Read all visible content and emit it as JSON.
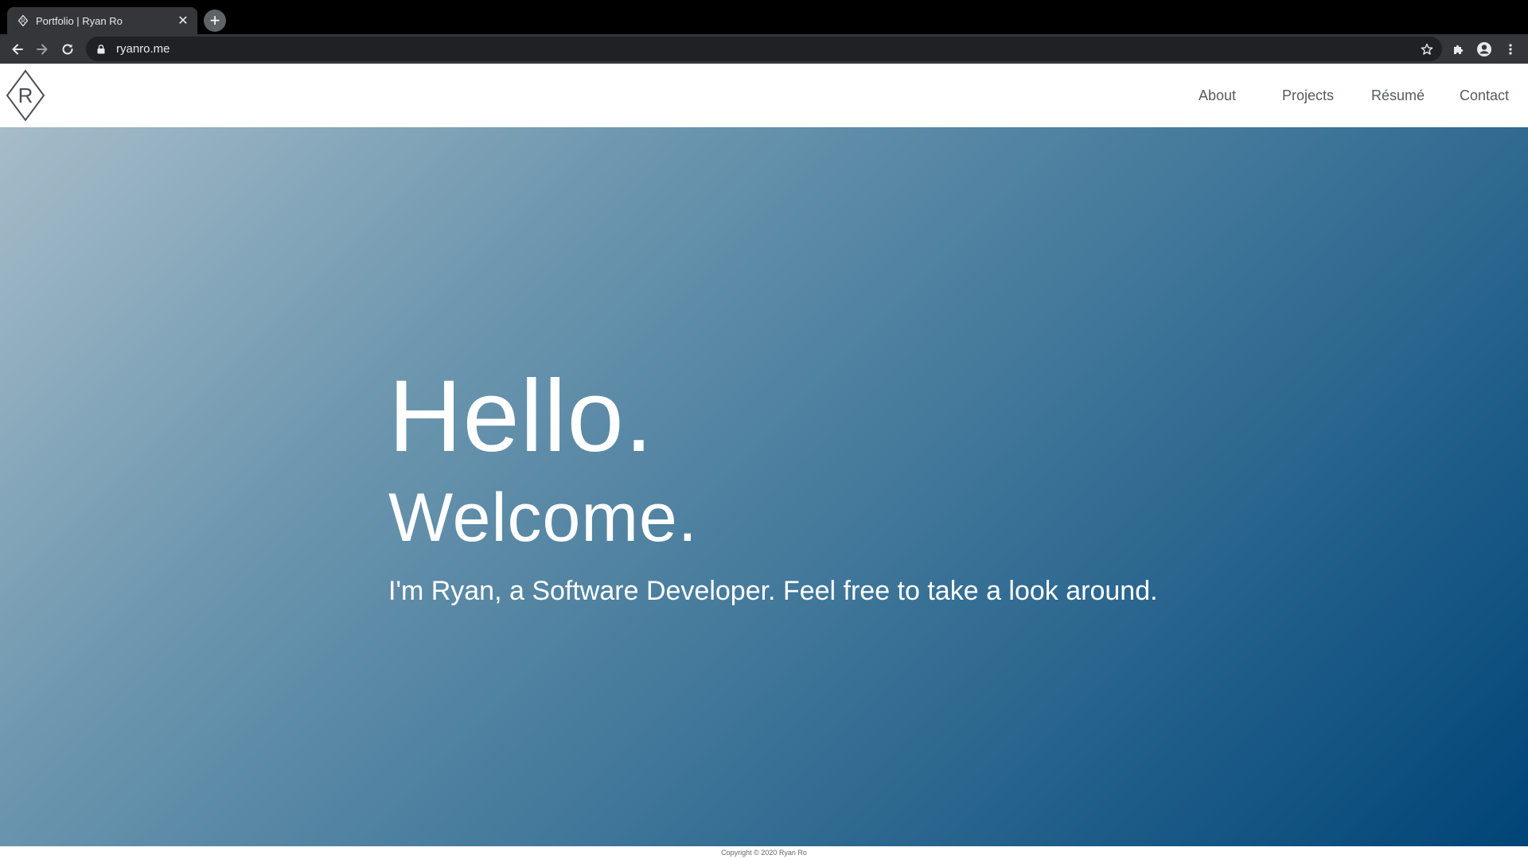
{
  "browser": {
    "tab": {
      "title": "Portfolio | Ryan Ro",
      "favicon": "diamond-r-favicon",
      "close_icon": "close-icon"
    },
    "new_tab_icon": "plus-icon",
    "nav": {
      "back_icon": "arrow-left-icon",
      "forward_icon": "arrow-right-icon",
      "reload_icon": "reload-icon"
    },
    "address_bar": {
      "url": "ryanro.me",
      "lock_icon": "lock-icon",
      "bookmark_icon": "star-icon"
    },
    "extensions_icon": "puzzle-icon",
    "profile_icon": "account-circle-icon",
    "menu_icon": "more-vert-icon"
  },
  "site": {
    "logo": {
      "icon": "diamond-r-logo",
      "letter": "R"
    },
    "nav": {
      "items": [
        {
          "label": "About"
        },
        {
          "label": "Projects"
        },
        {
          "label": "Résumé"
        },
        {
          "label": "Contact"
        }
      ]
    },
    "hero": {
      "greeting": "Hello.",
      "welcome": "Welcome.",
      "subtitle": "I'm Ryan, a Software Developer. Feel free to take a look around."
    },
    "footer": {
      "copyright": "Copyright © 2020 Ryan Ro"
    }
  },
  "colors": {
    "chrome_bg": "#000000",
    "toolbar_bg": "#35363a",
    "omnibox_bg": "#202124",
    "nav_text": "#555b61",
    "hero_gradient_start": "#a6bcc9",
    "hero_gradient_end": "#004577"
  }
}
